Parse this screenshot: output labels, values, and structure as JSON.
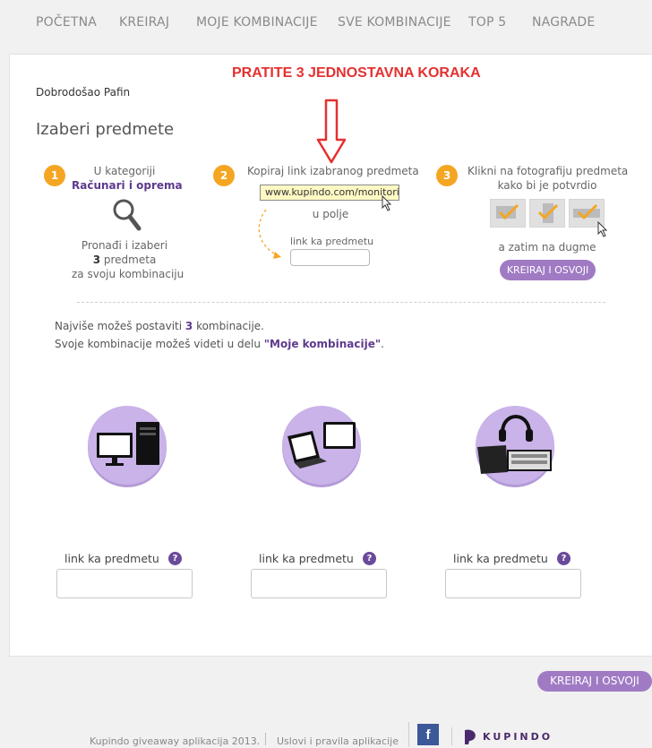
{
  "nav": {
    "items": [
      "POČETNA",
      "KREIRAJ",
      "MOJE KOMBINACIJE",
      "SVE KOMBINACIJE",
      "TOP 5",
      "NAGRADE"
    ]
  },
  "headline": "PRATITE 3 JEDNOSTAVNA KORAKA",
  "welcome": "Dobrodošao Pafin",
  "title": "Izaberi predmete",
  "steps": {
    "s1": {
      "num": "1",
      "line1": "U kategoriji",
      "category": "Računari i oprema",
      "line3": "Pronađi i izaberi",
      "count": "3",
      "count_suffix": " predmeta",
      "line5": "za svoju kombinaciju"
    },
    "s2": {
      "num": "2",
      "line1": "Kopiraj link izabranog predmeta",
      "url": "www.kupindo.com/monitori/...",
      "line3": "u polje",
      "field_label": "link ka predmetu"
    },
    "s3": {
      "num": "3",
      "line1": "Klikni na fotografiju predmeta",
      "line2": "kako bi je potvrdio",
      "line3": "a zatim na dugme",
      "button": "KREIRAJ I OSVOJI"
    }
  },
  "info": {
    "line1_pre": "Najviše možeš postaviti ",
    "line1_num": "3",
    "line1_post": " kombinacije.",
    "line2_pre": "Svoje kombinacije možeš videti u delu ",
    "line2_link": "\"Moje kombinacije\"",
    "line2_post": "."
  },
  "categories": [
    {
      "icon": "computer-icon",
      "label": "link ka predmetu",
      "help": "?"
    },
    {
      "icon": "laptop-tablet-icon",
      "label": "link ka predmetu",
      "help": "?"
    },
    {
      "icon": "accessories-icon",
      "label": "link ka predmetu",
      "help": "?"
    }
  ],
  "submit_button": "KREIRAJ I OSVOJI",
  "footer": {
    "app": "Kupindo giveaway aplikacija 2013.",
    "terms": "Uslovi i pravila aplikacije",
    "fb": "f",
    "brand": "KUPINDO"
  },
  "colors": {
    "accent": "#a07bc4",
    "step": "#f4a623",
    "headline": "#e53030",
    "purple_text": "#5e3a8c"
  }
}
